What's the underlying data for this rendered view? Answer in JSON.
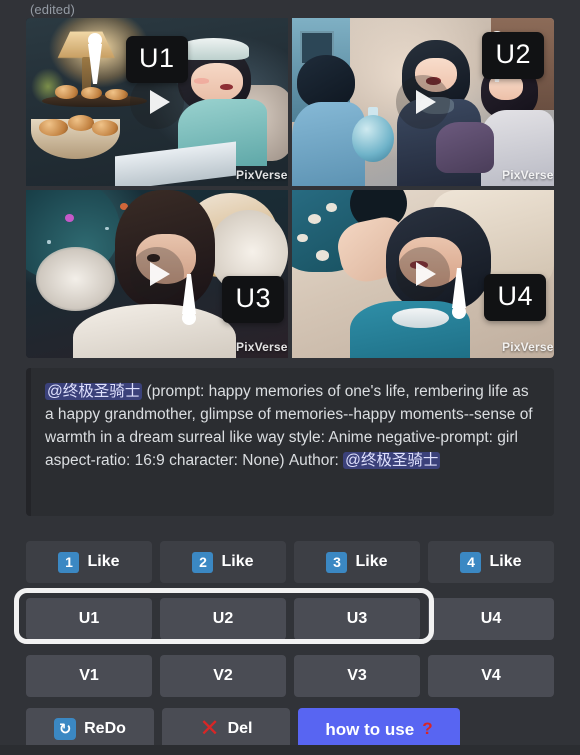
{
  "message": {
    "edited_label": "(edited)"
  },
  "grid": {
    "watermark": "PixVerse",
    "cells": [
      {
        "badge": "U1",
        "alt": "girl reading in bed with lamp and pastries"
      },
      {
        "badge": "U2",
        "alt": "three girls with a glowing globe"
      },
      {
        "badge": "U3",
        "alt": "girl resting in bed under night sky"
      },
      {
        "badge": "U4",
        "alt": "girl lying down with blue abstract shapes"
      }
    ]
  },
  "prompt": {
    "author_mention": "@终极圣骑士",
    "body_1": " (prompt: happy memories of one's life, rembering life as a happy grandmother, glimpse of memories--happy moments--sense of warmth in a dream surreal like way style: Anime negative-prompt: girl aspect-ratio: 16:9 character: None) Author: ",
    "author_label": "@终极圣骑士"
  },
  "buttons": {
    "like_row": [
      {
        "num": "1",
        "label": "Like"
      },
      {
        "num": "2",
        "label": "Like"
      },
      {
        "num": "3",
        "label": "Like"
      },
      {
        "num": "4",
        "label": "Like"
      }
    ],
    "u_row": [
      {
        "label": "U1"
      },
      {
        "label": "U2"
      },
      {
        "label": "U3"
      },
      {
        "label": "U4"
      }
    ],
    "v_row": [
      {
        "label": "V1"
      },
      {
        "label": "V2"
      },
      {
        "label": "V3"
      },
      {
        "label": "V4"
      }
    ],
    "action_row": {
      "redo": {
        "icon": "refresh-icon",
        "glyph": "↻",
        "label": "ReDo"
      },
      "del": {
        "icon": "cross-mark-icon",
        "glyph": "✕",
        "label": "Del"
      },
      "how": {
        "label": "how to use ",
        "q": "?"
      }
    }
  },
  "colors": {
    "background": "#313338",
    "embed_bg": "#2b2d31",
    "embed_bar": "#232428",
    "button_bg": "#4a4c54",
    "blurple": "#5865f2",
    "badge_blue": "#3b88c3",
    "red": "#d92626",
    "highlight": "#f2f2f2"
  }
}
